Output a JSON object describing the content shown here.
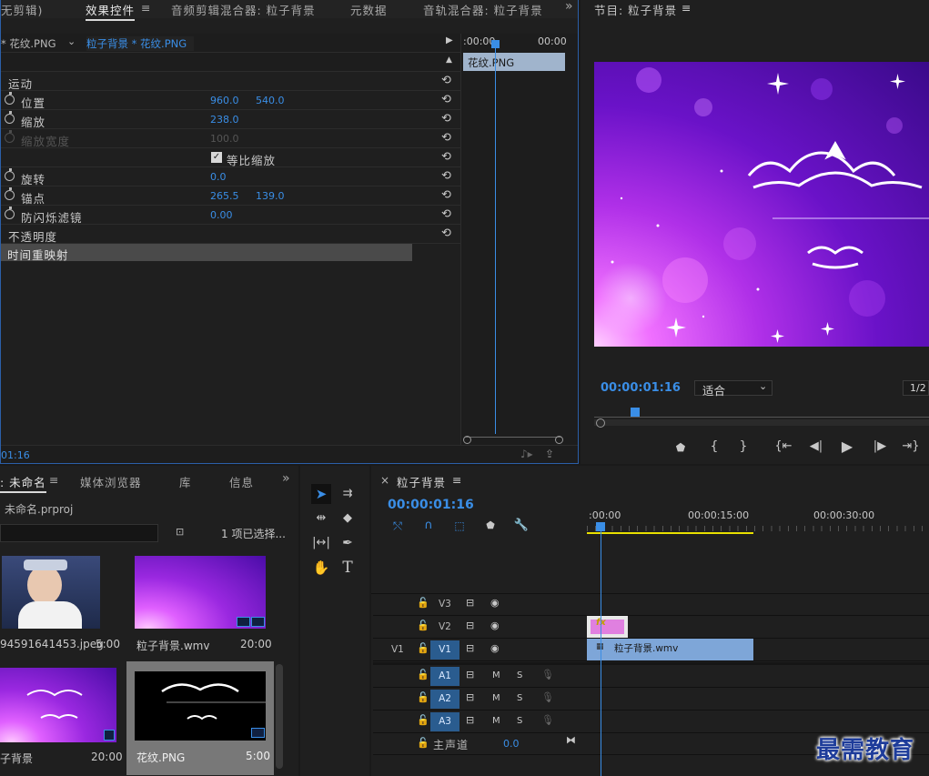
{
  "effect_panel": {
    "tabs": [
      "无剪辑)",
      "效果控件",
      "音频剪辑混合器: 粒子背景",
      "元数据",
      "音轨混合器: 粒子背景"
    ],
    "menu_icon": "≡",
    "overflow": "»",
    "source_left": "* 花纹.PNG",
    "source_active": "粒子背景 * 花纹.PNG",
    "mini_time_start": ":00:00",
    "mini_time_end": "00:00",
    "clip_label": "花纹.PNG",
    "section_motion": "运动",
    "props": [
      {
        "label": "位置",
        "v1": "960.0",
        "v2": "540.0"
      },
      {
        "label": "缩放",
        "v1": "238.0",
        "v2": ""
      },
      {
        "label": "缩放宽度",
        "v1": "100.0",
        "v2": ""
      },
      {
        "label": "等比缩放",
        "v1": "",
        "v2": ""
      },
      {
        "label": "旋转",
        "v1": "0.0",
        "v2": ""
      },
      {
        "label": "锚点",
        "v1": "265.5",
        "v2": "139.0"
      },
      {
        "label": "防闪烁滤镜",
        "v1": "0.00",
        "v2": ""
      }
    ],
    "section_opacity": "不透明度",
    "section_time_remap": "时间重映射",
    "timecode": "01:16"
  },
  "program_monitor": {
    "title": "节目: 粒子背景",
    "menu_icon": "≡",
    "timecode": "00:00:01:16",
    "fit": "适合",
    "resolution": "1/2",
    "controls": [
      "marker-icon",
      "in-point-icon",
      "out-point-icon",
      "go-to-in-icon",
      "step-back-icon",
      "play-icon",
      "step-forward-icon",
      "go-to-out-icon"
    ]
  },
  "project_panel": {
    "tabs": [
      ": 未命名",
      "媒体浏览器",
      "库",
      "信息"
    ],
    "menu_icon": "≡",
    "overflow": "»",
    "project_file": "未命名.prproj",
    "selection": "1 项已选择...",
    "items": [
      {
        "name": "94591641453.jpeg",
        "duration": "5:00"
      },
      {
        "name": "粒子背景.wmv",
        "duration": "20:00"
      },
      {
        "name": "子背景",
        "duration": "20:00"
      },
      {
        "name": "花纹.PNG",
        "duration": "5:00"
      }
    ]
  },
  "timeline": {
    "close": "×",
    "title": "粒子背景",
    "menu_icon": "≡",
    "timecode": "00:00:01:16",
    "ruler": [
      ":00:00",
      "00:00:15:00",
      "00:00:30:00"
    ],
    "fx": "fx",
    "clip_v1": "粒子背景.wmv",
    "master_label": "主声道",
    "master_value": "0.0",
    "tracks": [
      {
        "name": "V3",
        "src": "",
        "type": "video"
      },
      {
        "name": "V2",
        "src": "",
        "type": "video"
      },
      {
        "name": "V1",
        "src": "V1",
        "type": "video"
      },
      {
        "name": "A1",
        "src": "",
        "type": "audio"
      },
      {
        "name": "A2",
        "src": "",
        "type": "audio"
      },
      {
        "name": "A3",
        "src": "",
        "type": "audio"
      }
    ],
    "m": "M",
    "s": "S"
  },
  "watermark": "最需教育"
}
